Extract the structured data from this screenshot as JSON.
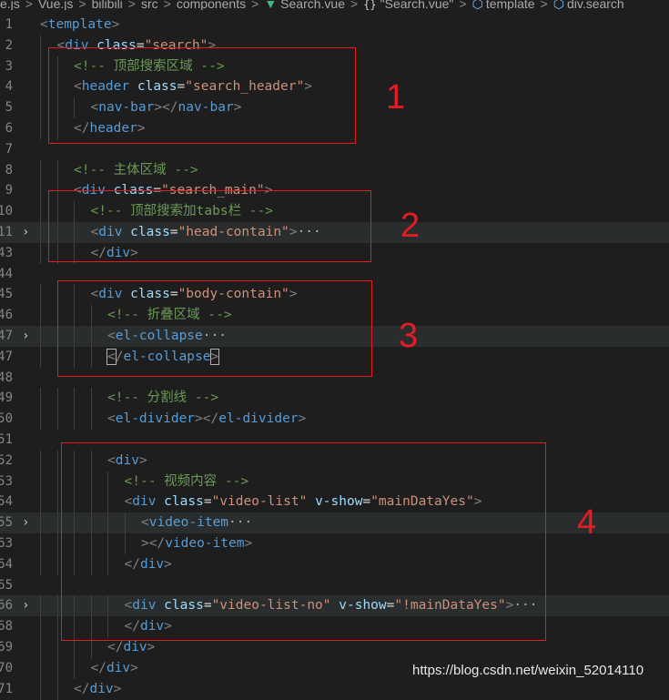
{
  "breadcrumb": {
    "items": [
      "e.js",
      "Vue.js",
      "bilibili",
      "src",
      "components"
    ],
    "file": "Search.vue",
    "section": "\"Search.vue\"",
    "template": "template",
    "div": "div.search"
  },
  "lines": [
    {
      "n": "1",
      "fold": false,
      "hl": false,
      "indent": 0,
      "tokens": [
        [
          "b",
          "<"
        ],
        [
          "t",
          "template"
        ],
        [
          "b",
          ">"
        ]
      ]
    },
    {
      "n": "2",
      "fold": false,
      "hl": false,
      "indent": 1,
      "tokens": [
        [
          "b",
          "<"
        ],
        [
          "t",
          "div"
        ],
        [
          "p",
          " "
        ],
        [
          "a",
          "class"
        ],
        [
          "p",
          "="
        ],
        [
          "s",
          "\"search\""
        ],
        [
          "b",
          ">"
        ]
      ]
    },
    {
      "n": "3",
      "fold": false,
      "hl": false,
      "indent": 2,
      "tokens": [
        [
          "c",
          "<!-- 顶部搜索区域 -->"
        ]
      ]
    },
    {
      "n": "4",
      "fold": false,
      "hl": false,
      "indent": 2,
      "tokens": [
        [
          "b",
          "<"
        ],
        [
          "t",
          "header"
        ],
        [
          "p",
          " "
        ],
        [
          "a",
          "class"
        ],
        [
          "p",
          "="
        ],
        [
          "s",
          "\"search_header\""
        ],
        [
          "b",
          ">"
        ]
      ]
    },
    {
      "n": "5",
      "fold": false,
      "hl": false,
      "indent": 3,
      "tokens": [
        [
          "b",
          "<"
        ],
        [
          "t",
          "nav-bar"
        ],
        [
          "b",
          "></"
        ],
        [
          "t",
          "nav-bar"
        ],
        [
          "b",
          ">"
        ]
      ]
    },
    {
      "n": "6",
      "fold": false,
      "hl": false,
      "indent": 2,
      "tokens": [
        [
          "b",
          "</"
        ],
        [
          "t",
          "header"
        ],
        [
          "b",
          ">"
        ]
      ]
    },
    {
      "n": "7",
      "fold": false,
      "hl": false,
      "indent": 0,
      "tokens": []
    },
    {
      "n": "8",
      "fold": false,
      "hl": false,
      "indent": 2,
      "tokens": [
        [
          "c",
          "<!-- 主体区域 -->"
        ]
      ]
    },
    {
      "n": "9",
      "fold": false,
      "hl": false,
      "indent": 2,
      "tokens": [
        [
          "b",
          "<"
        ],
        [
          "t",
          "div"
        ],
        [
          "p",
          " "
        ],
        [
          "a",
          "class"
        ],
        [
          "p",
          "="
        ],
        [
          "s",
          "\"search_main\""
        ],
        [
          "b",
          ">"
        ]
      ]
    },
    {
      "n": "10",
      "fold": false,
      "hl": false,
      "indent": 3,
      "tokens": [
        [
          "c",
          "<!-- 顶部搜索加tabs栏 -->"
        ]
      ]
    },
    {
      "n": "11",
      "fold": true,
      "hl": true,
      "indent": 3,
      "tokens": [
        [
          "b",
          "<"
        ],
        [
          "t",
          "div"
        ],
        [
          "p",
          " "
        ],
        [
          "a",
          "class"
        ],
        [
          "p",
          "="
        ],
        [
          "s",
          "\"head-contain\""
        ],
        [
          "b",
          ">"
        ],
        [
          "e",
          "···"
        ]
      ]
    },
    {
      "n": "43",
      "fold": false,
      "hl": false,
      "indent": 3,
      "tokens": [
        [
          "b",
          "</"
        ],
        [
          "t",
          "div"
        ],
        [
          "b",
          ">"
        ]
      ]
    },
    {
      "n": "44",
      "fold": false,
      "hl": false,
      "indent": 0,
      "tokens": []
    },
    {
      "n": "45",
      "fold": false,
      "hl": false,
      "indent": 3,
      "tokens": [
        [
          "b",
          "<"
        ],
        [
          "t",
          "div"
        ],
        [
          "p",
          " "
        ],
        [
          "a",
          "class"
        ],
        [
          "p",
          "="
        ],
        [
          "s",
          "\"body-contain\""
        ],
        [
          "b",
          ">"
        ]
      ]
    },
    {
      "n": "46",
      "fold": false,
      "hl": false,
      "indent": 4,
      "tokens": [
        [
          "c",
          "<!-- 折叠区域 -->"
        ]
      ]
    },
    {
      "n": "47",
      "fold": true,
      "hl": true,
      "indent": 4,
      "tokens": [
        [
          "b",
          "<"
        ],
        [
          "t",
          "el-collapse"
        ],
        [
          "e",
          "···"
        ]
      ]
    },
    {
      "n": "47",
      "fold": false,
      "hl": false,
      "indent": 4,
      "tokens": [
        [
          "k",
          "<"
        ],
        [
          "b",
          "/"
        ],
        [
          "t",
          "el-collapse"
        ],
        [
          "k",
          ">"
        ]
      ]
    },
    {
      "n": "48",
      "fold": false,
      "hl": false,
      "indent": 0,
      "tokens": []
    },
    {
      "n": "49",
      "fold": false,
      "hl": false,
      "indent": 4,
      "tokens": [
        [
          "c",
          "<!-- 分割线 -->"
        ]
      ]
    },
    {
      "n": "50",
      "fold": false,
      "hl": false,
      "indent": 4,
      "tokens": [
        [
          "b",
          "<"
        ],
        [
          "t",
          "el-divider"
        ],
        [
          "b",
          "></"
        ],
        [
          "t",
          "el-divider"
        ],
        [
          "b",
          ">"
        ]
      ]
    },
    {
      "n": "51",
      "fold": false,
      "hl": false,
      "indent": 0,
      "tokens": []
    },
    {
      "n": "52",
      "fold": false,
      "hl": false,
      "indent": 4,
      "tokens": [
        [
          "b",
          "<"
        ],
        [
          "t",
          "div"
        ],
        [
          "b",
          ">"
        ]
      ]
    },
    {
      "n": "53",
      "fold": false,
      "hl": false,
      "indent": 5,
      "tokens": [
        [
          "c",
          "<!-- 视频内容 -->"
        ]
      ]
    },
    {
      "n": "54",
      "fold": false,
      "hl": false,
      "indent": 5,
      "tokens": [
        [
          "b",
          "<"
        ],
        [
          "t",
          "div"
        ],
        [
          "p",
          " "
        ],
        [
          "a",
          "class"
        ],
        [
          "p",
          "="
        ],
        [
          "s",
          "\"video-list\""
        ],
        [
          "p",
          " "
        ],
        [
          "a",
          "v-show"
        ],
        [
          "p",
          "="
        ],
        [
          "s",
          "\"mainDataYes\""
        ],
        [
          "b",
          ">"
        ]
      ]
    },
    {
      "n": "55",
      "fold": true,
      "hl": true,
      "indent": 6,
      "tokens": [
        [
          "b",
          "<"
        ],
        [
          "t",
          "video-item"
        ],
        [
          "e",
          "···"
        ]
      ]
    },
    {
      "n": "63",
      "fold": false,
      "hl": false,
      "indent": 6,
      "tokens": [
        [
          "b",
          "></"
        ],
        [
          "t",
          "video-item"
        ],
        [
          "b",
          ">"
        ]
      ]
    },
    {
      "n": "64",
      "fold": false,
      "hl": false,
      "indent": 5,
      "tokens": [
        [
          "b",
          "</"
        ],
        [
          "t",
          "div"
        ],
        [
          "b",
          ">"
        ]
      ]
    },
    {
      "n": "65",
      "fold": false,
      "hl": false,
      "indent": 0,
      "tokens": []
    },
    {
      "n": "66",
      "fold": true,
      "hl": true,
      "indent": 5,
      "tokens": [
        [
          "b",
          "<"
        ],
        [
          "t",
          "div"
        ],
        [
          "p",
          " "
        ],
        [
          "a",
          "class"
        ],
        [
          "p",
          "="
        ],
        [
          "s",
          "\"video-list-no\""
        ],
        [
          "p",
          " "
        ],
        [
          "a",
          "v-show"
        ],
        [
          "p",
          "="
        ],
        [
          "s",
          "\"!mainDataYes\""
        ],
        [
          "b",
          ">"
        ],
        [
          "e",
          "···"
        ]
      ]
    },
    {
      "n": "68",
      "fold": false,
      "hl": false,
      "indent": 5,
      "tokens": [
        [
          "b",
          "</"
        ],
        [
          "t",
          "div"
        ],
        [
          "b",
          ">"
        ]
      ]
    },
    {
      "n": "69",
      "fold": false,
      "hl": false,
      "indent": 4,
      "tokens": [
        [
          "b",
          "</"
        ],
        [
          "t",
          "div"
        ],
        [
          "b",
          ">"
        ]
      ]
    },
    {
      "n": "70",
      "fold": false,
      "hl": false,
      "indent": 3,
      "tokens": [
        [
          "b",
          "</"
        ],
        [
          "t",
          "div"
        ],
        [
          "b",
          ">"
        ]
      ]
    },
    {
      "n": "71",
      "fold": false,
      "hl": false,
      "indent": 2,
      "tokens": [
        [
          "b",
          "</"
        ],
        [
          "t",
          "div"
        ],
        [
          "b",
          ">"
        ]
      ]
    }
  ],
  "annotations": [
    {
      "label": "1"
    },
    {
      "label": "2"
    },
    {
      "label": "3"
    },
    {
      "label": "4"
    }
  ],
  "watermark": "https://blog.csdn.net/weixin_52014110",
  "colors": {
    "annotation": "#e51c23",
    "background": "#1e1e1e",
    "tag": "#569cd6",
    "attr": "#9cdcfe",
    "string": "#ce9178",
    "comment": "#6a9955"
  }
}
